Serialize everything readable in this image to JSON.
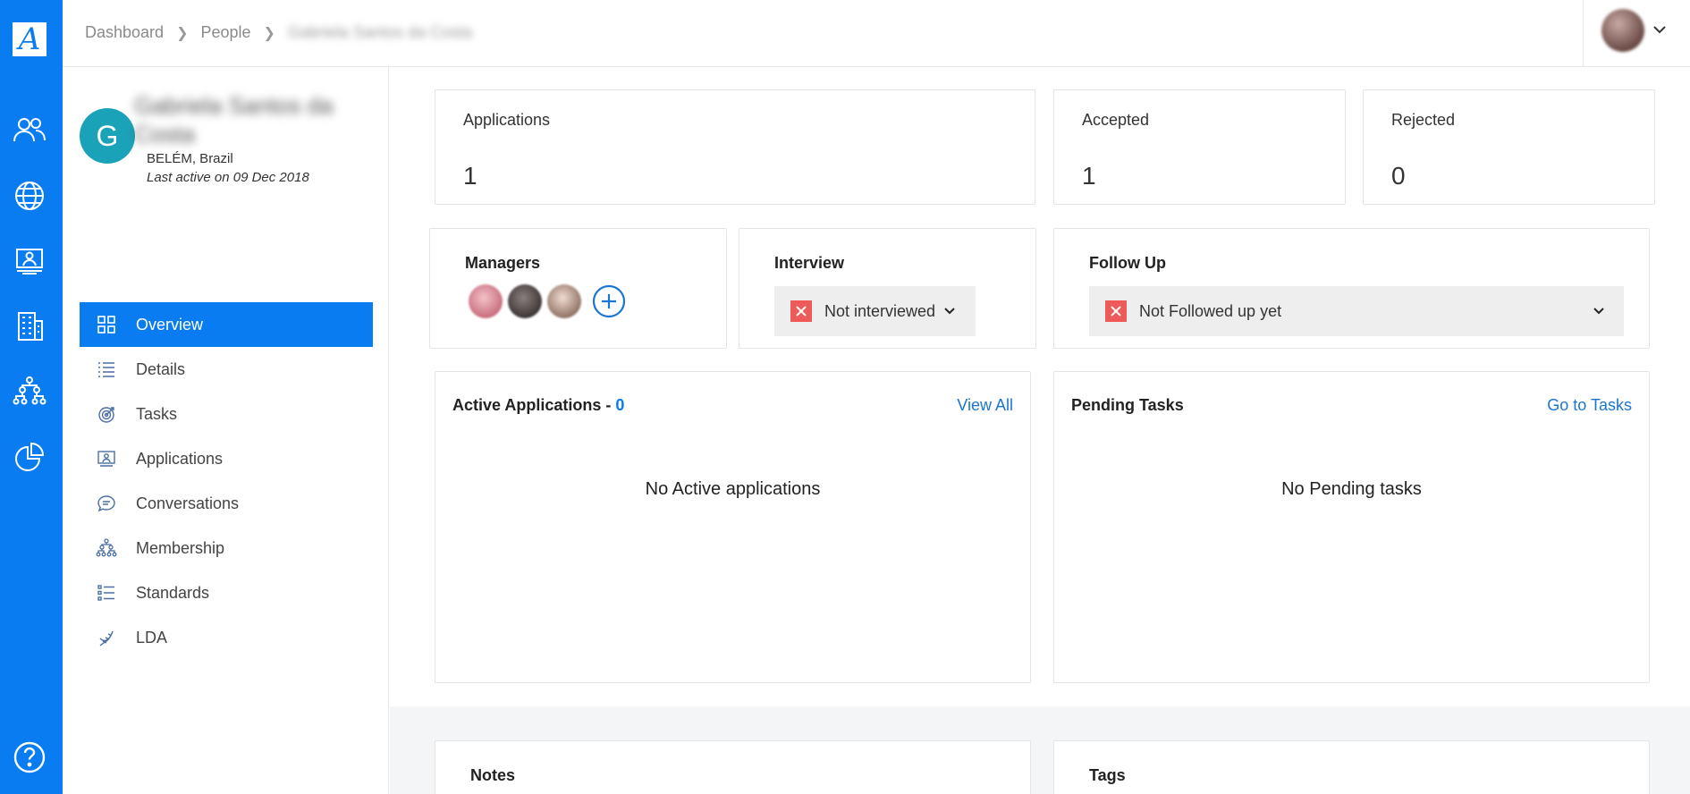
{
  "rail": {
    "logo": "A",
    "icons": [
      "people-icon",
      "globe-icon",
      "monitor-user-icon",
      "building-icon",
      "org-chart-icon",
      "pie-chart-icon",
      "help-icon"
    ]
  },
  "breadcrumb": {
    "items": [
      "Dashboard",
      "People"
    ],
    "current": "Gabriela Santos da Costa"
  },
  "profile": {
    "initial": "G",
    "name": "Gabriela Santos da Costa",
    "location": "BELÉM, Brazil",
    "last_active": "Last active on 09 Dec 2018"
  },
  "nav": {
    "items": [
      {
        "label": "Overview",
        "icon": "grid-icon"
      },
      {
        "label": "Details",
        "icon": "list-icon"
      },
      {
        "label": "Tasks",
        "icon": "target-icon"
      },
      {
        "label": "Applications",
        "icon": "monitor-user-icon"
      },
      {
        "label": "Conversations",
        "icon": "chat-icon"
      },
      {
        "label": "Membership",
        "icon": "org-chart-icon"
      },
      {
        "label": "Standards",
        "icon": "checklist-icon"
      },
      {
        "label": "LDA",
        "icon": "dna-icon"
      }
    ]
  },
  "stats": {
    "applications": {
      "label": "Applications",
      "value": "1"
    },
    "accepted": {
      "label": "Accepted",
      "value": "1"
    },
    "rejected": {
      "label": "Rejected",
      "value": "0"
    }
  },
  "managers": {
    "label": "Managers"
  },
  "interview": {
    "label": "Interview",
    "value": "Not interviewed"
  },
  "followup": {
    "label": "Follow Up",
    "value": "Not Followed up yet"
  },
  "active_apps": {
    "label": "Active Applications - ",
    "count": "0",
    "link": "View All",
    "empty": "No Active applications"
  },
  "pending": {
    "label": "Pending Tasks",
    "link": "Go to Tasks",
    "empty": "No Pending tasks"
  },
  "notes": {
    "label": "Notes"
  },
  "tags": {
    "label": "Tags"
  },
  "colors": {
    "accent": "#0a7cf2",
    "danger": "#ef5a5a",
    "avatar": "#1aa3b8"
  }
}
